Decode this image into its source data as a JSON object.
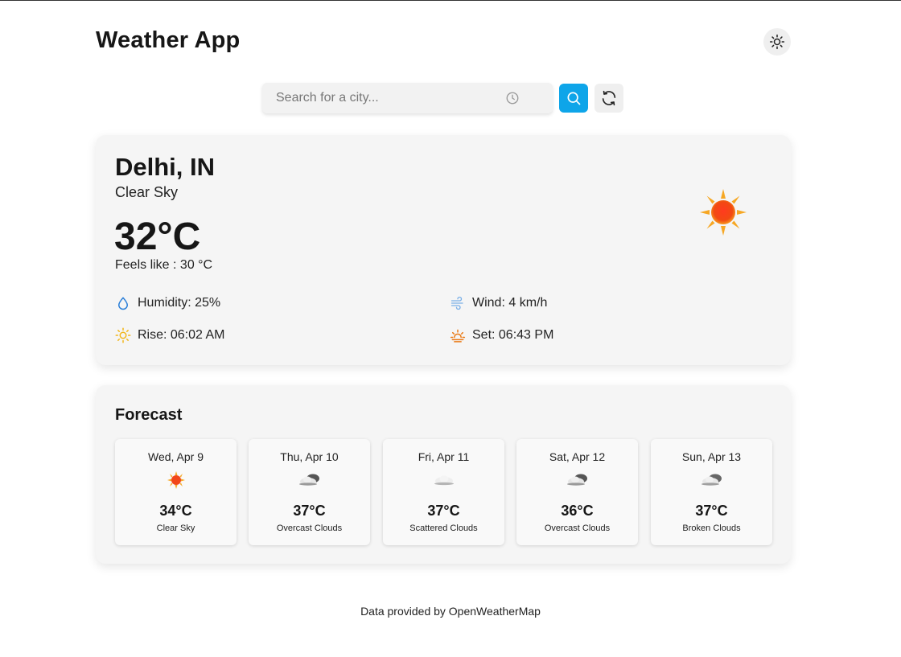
{
  "app": {
    "title": "Weather App"
  },
  "search": {
    "placeholder": "Search for a city...",
    "value": ""
  },
  "current": {
    "city": "Delhi, IN",
    "condition": "Clear Sky",
    "temperature": "32°C",
    "feels_like": "Feels like : 30 °C",
    "icon": "sun-icon",
    "details": {
      "humidity": "Humidity: 25%",
      "wind": "Wind: 4 km/h",
      "sunrise": "Rise: 06:02 AM",
      "sunset": "Set: 06:43 PM"
    }
  },
  "forecast": {
    "title": "Forecast",
    "days": [
      {
        "date": "Wed, Apr 9",
        "temp": "34°C",
        "desc": "Clear Sky",
        "icon": "sun-icon"
      },
      {
        "date": "Thu, Apr 10",
        "temp": "37°C",
        "desc": "Overcast Clouds",
        "icon": "overcast-clouds-icon"
      },
      {
        "date": "Fri, Apr 11",
        "temp": "37°C",
        "desc": "Scattered Clouds",
        "icon": "scattered-clouds-icon"
      },
      {
        "date": "Sat, Apr 12",
        "temp": "36°C",
        "desc": "Overcast Clouds",
        "icon": "overcast-clouds-icon"
      },
      {
        "date": "Sun, Apr 13",
        "temp": "37°C",
        "desc": "Broken Clouds",
        "icon": "broken-clouds-icon"
      }
    ]
  },
  "footer": {
    "text": "Data provided by OpenWeatherMap"
  },
  "colors": {
    "accent": "#0ea5e9",
    "card": "#f5f5f5",
    "sun": "#f97316"
  }
}
